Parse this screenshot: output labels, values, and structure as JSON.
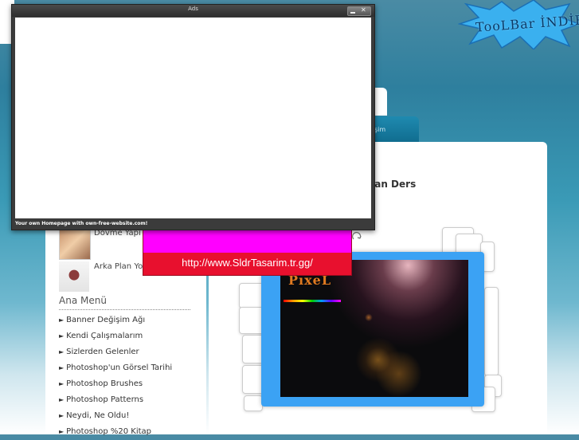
{
  "ads_window": {
    "title": "Ads",
    "footer": "Your own Homepage with own-free-website.com!"
  },
  "toolbar_logo": {
    "text": "TooLBar İNDİR"
  },
  "background_tab": {
    "label": "şim"
  },
  "main": {
    "heading": "ılan Ders"
  },
  "sidebar": {
    "thumbs": [
      {
        "label": "Dövme Yapı"
      },
      {
        "label": "Arka Plan Yol"
      }
    ],
    "menu_title": "Ana Menü",
    "menu_arrow": "►",
    "menu": [
      "Banner Değişim Ağı",
      "Kendi Çalışmalarım",
      "Sizlerden Gelenler",
      "Photoshop'un Görsel Tarihi",
      "Photoshop Brushes",
      "Photoshop Patterns",
      "Neydi, Ne Oldu!",
      "Photoshop %20 Kitap"
    ]
  },
  "banner": {
    "url": "http://www.SldrTasarim.tr.gg/",
    "top_color": "#ff00ff",
    "bottom_color": "#e8102e"
  },
  "slideshow": {
    "logo_text": "PıxeL"
  }
}
